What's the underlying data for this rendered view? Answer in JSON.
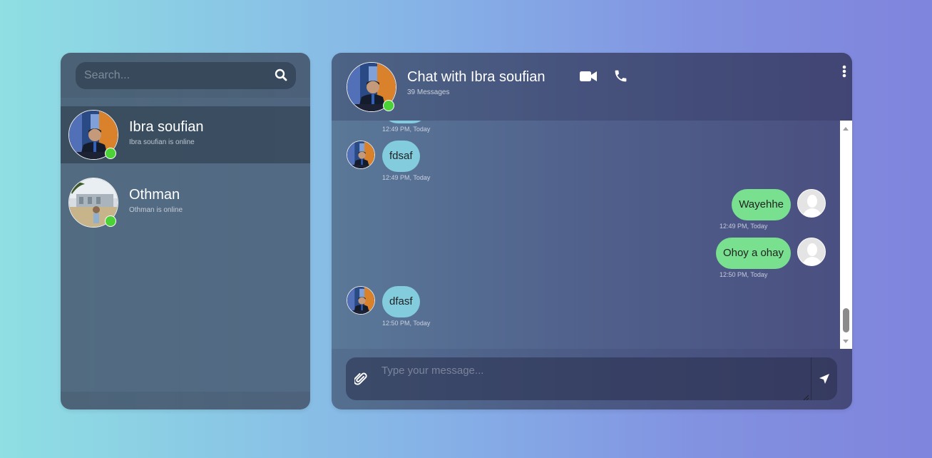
{
  "search": {
    "placeholder": "Search..."
  },
  "contacts": [
    {
      "name": "Ibra soufian",
      "status": "Ibra soufian is online",
      "online": true,
      "active": true
    },
    {
      "name": "Othman",
      "status": "Othman is online",
      "online": true,
      "active": false
    }
  ],
  "chat": {
    "title": "Chat with Ibra soufian",
    "message_count": "39 Messages"
  },
  "messages": [
    {
      "time": "12:49 PM, Today"
    },
    {
      "text": "fdsaf",
      "time": "12:49 PM, Today",
      "direction": "in"
    },
    {
      "text": "Wayehhe",
      "time": "12:49 PM, Today",
      "direction": "out"
    },
    {
      "text": "Ohoy a ohay",
      "time": "12:50 PM, Today",
      "direction": "out"
    },
    {
      "text": "dfasf",
      "time": "12:50 PM, Today",
      "direction": "in"
    }
  ],
  "composer": {
    "placeholder": "Type your message..."
  },
  "icons": {
    "search": "search-icon",
    "video": "video-camera-icon",
    "phone": "phone-icon",
    "menu": "vertical-ellipsis-icon",
    "attach": "paperclip-icon",
    "send": "paper-plane-icon"
  },
  "colors": {
    "incoming_bubble": "#82ccdd",
    "outgoing_bubble": "#78e08f",
    "online": "#4cd137"
  }
}
